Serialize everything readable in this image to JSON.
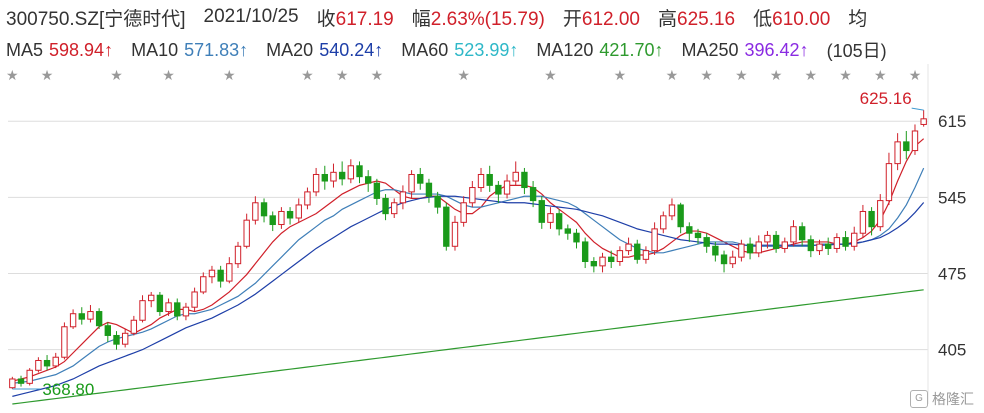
{
  "header": {
    "code": "300750.SZ[宁德时代]",
    "date": "2021/10/25",
    "close_label": "收",
    "close": "617.19",
    "chg_label": "幅",
    "chg": "2.63%(15.79)",
    "open_label": "开",
    "open": "612.00",
    "high_label": "高",
    "high": "625.16",
    "low_label": "低",
    "low": "610.00",
    "avg_label": "均"
  },
  "ma_legend": [
    {
      "label": "MA5",
      "value": "598.94↑",
      "color": "#d0202a"
    },
    {
      "label": "MA10",
      "value": "571.83↑",
      "color": "#3f7fb8"
    },
    {
      "label": "MA20",
      "value": "540.24↑",
      "color": "#1e3fa8"
    },
    {
      "label": "MA60",
      "value": "523.99↑",
      "color": "#2fb8c8"
    },
    {
      "label": "MA120",
      "value": "421.70↑",
      "color": "#2e9a2e"
    },
    {
      "label": "MA250",
      "value": "396.42↑",
      "color": "#8a2be2"
    },
    {
      "label": "",
      "value": "(105日)",
      "color": "#333333"
    }
  ],
  "watermark": {
    "logo_text": "G",
    "text": "格隆汇"
  },
  "colors": {
    "up": "#d0202a",
    "down": "#1a9a1a",
    "grid": "#dddddd"
  },
  "chart_data": {
    "type": "candlestick",
    "ylim": [
      355,
      640
    ],
    "yticks": [
      405,
      475,
      545,
      615
    ],
    "high_label": "625.16",
    "low_label": "368.80",
    "candles": [
      [
        370,
        378,
        368.8,
        380
      ],
      [
        378,
        374,
        371,
        381
      ],
      [
        374,
        386,
        372,
        388
      ],
      [
        386,
        395,
        384,
        398
      ],
      [
        395,
        390,
        386,
        400
      ],
      [
        390,
        398,
        388,
        402
      ],
      [
        398,
        426,
        396,
        430
      ],
      [
        426,
        438,
        424,
        442
      ],
      [
        438,
        433,
        428,
        444
      ],
      [
        433,
        440,
        430,
        446
      ],
      [
        440,
        427,
        424,
        443
      ],
      [
        427,
        418,
        412,
        430
      ],
      [
        418,
        410,
        405,
        422
      ],
      [
        410,
        420,
        407,
        424
      ],
      [
        420,
        432,
        418,
        436
      ],
      [
        432,
        450,
        430,
        455
      ],
      [
        450,
        455,
        444,
        458
      ],
      [
        455,
        440,
        436,
        458
      ],
      [
        440,
        448,
        436,
        452
      ],
      [
        448,
        436,
        432,
        452
      ],
      [
        436,
        444,
        432,
        448
      ],
      [
        444,
        458,
        440,
        462
      ],
      [
        458,
        472,
        456,
        476
      ],
      [
        472,
        478,
        466,
        482
      ],
      [
        478,
        468,
        462,
        482
      ],
      [
        468,
        484,
        466,
        490
      ],
      [
        484,
        500,
        480,
        504
      ],
      [
        500,
        524,
        498,
        530
      ],
      [
        524,
        540,
        520,
        546
      ],
      [
        540,
        528,
        522,
        544
      ],
      [
        528,
        520,
        514,
        532
      ],
      [
        520,
        532,
        516,
        536
      ],
      [
        532,
        526,
        520,
        536
      ],
      [
        526,
        538,
        522,
        544
      ],
      [
        538,
        550,
        534,
        554
      ],
      [
        550,
        566,
        546,
        572
      ],
      [
        566,
        560,
        552,
        574
      ],
      [
        560,
        568,
        554,
        576
      ],
      [
        568,
        562,
        556,
        578
      ],
      [
        562,
        574,
        558,
        580
      ],
      [
        574,
        564,
        558,
        578
      ],
      [
        564,
        558,
        550,
        570
      ],
      [
        558,
        544,
        538,
        562
      ],
      [
        544,
        530,
        524,
        548
      ],
      [
        530,
        540,
        526,
        544
      ],
      [
        540,
        550,
        534,
        556
      ],
      [
        550,
        566,
        544,
        570
      ],
      [
        566,
        558,
        552,
        572
      ],
      [
        558,
        546,
        540,
        562
      ],
      [
        546,
        536,
        530,
        550
      ],
      [
        536,
        500,
        496,
        540
      ],
      [
        500,
        522,
        496,
        528
      ],
      [
        522,
        540,
        518,
        546
      ],
      [
        540,
        554,
        536,
        560
      ],
      [
        554,
        566,
        550,
        572
      ],
      [
        566,
        556,
        550,
        574
      ],
      [
        556,
        548,
        540,
        560
      ],
      [
        548,
        560,
        544,
        566
      ],
      [
        560,
        568,
        556,
        578
      ],
      [
        568,
        554,
        548,
        572
      ],
      [
        554,
        542,
        536,
        560
      ],
      [
        542,
        522,
        516,
        546
      ],
      [
        522,
        530,
        516,
        536
      ],
      [
        530,
        516,
        510,
        534
      ],
      [
        516,
        512,
        506,
        520
      ],
      [
        512,
        504,
        498,
        516
      ],
      [
        504,
        486,
        480,
        508
      ],
      [
        486,
        482,
        476,
        490
      ],
      [
        482,
        490,
        476,
        494
      ],
      [
        490,
        486,
        480,
        496
      ],
      [
        486,
        496,
        482,
        500
      ],
      [
        496,
        502,
        492,
        508
      ],
      [
        502,
        488,
        484,
        506
      ],
      [
        488,
        496,
        484,
        500
      ],
      [
        496,
        516,
        492,
        522
      ],
      [
        516,
        528,
        512,
        532
      ],
      [
        528,
        538,
        524,
        544
      ],
      [
        538,
        518,
        512,
        540
      ],
      [
        518,
        512,
        504,
        522
      ],
      [
        512,
        508,
        502,
        516
      ],
      [
        508,
        500,
        494,
        512
      ],
      [
        500,
        492,
        486,
        504
      ],
      [
        492,
        484,
        476,
        496
      ],
      [
        484,
        490,
        480,
        496
      ],
      [
        490,
        502,
        486,
        506
      ],
      [
        502,
        494,
        488,
        508
      ],
      [
        494,
        504,
        490,
        510
      ],
      [
        504,
        510,
        498,
        514
      ],
      [
        510,
        498,
        494,
        514
      ],
      [
        498,
        504,
        494,
        508
      ],
      [
        504,
        518,
        500,
        524
      ],
      [
        518,
        506,
        500,
        522
      ],
      [
        506,
        496,
        490,
        510
      ],
      [
        496,
        502,
        492,
        506
      ],
      [
        502,
        498,
        492,
        508
      ],
      [
        498,
        508,
        494,
        512
      ],
      [
        508,
        500,
        496,
        514
      ],
      [
        500,
        512,
        496,
        518
      ],
      [
        512,
        532,
        508,
        538
      ],
      [
        532,
        518,
        510,
        536
      ],
      [
        518,
        542,
        514,
        548
      ],
      [
        542,
        576,
        538,
        586
      ],
      [
        576,
        596,
        570,
        604
      ],
      [
        596,
        588,
        580,
        606
      ],
      [
        588,
        606,
        584,
        612
      ],
      [
        612,
        617.19,
        610,
        625.16
      ]
    ],
    "series": [
      {
        "name": "MA5",
        "color": "#d0202a",
        "values": [
          376,
          378,
          380,
          383,
          386,
          389,
          394,
          402,
          410,
          418,
          426,
          430,
          428,
          424,
          420,
          424,
          428,
          434,
          438,
          442,
          442,
          440,
          442,
          446,
          452,
          458,
          466,
          474,
          484,
          494,
          504,
          512,
          518,
          522,
          526,
          530,
          536,
          542,
          548,
          552,
          556,
          558,
          560,
          558,
          552,
          546,
          544,
          544,
          546,
          546,
          540,
          534,
          530,
          530,
          536,
          546,
          552,
          556,
          556,
          556,
          554,
          548,
          540,
          534,
          528,
          522,
          512,
          504,
          498,
          494,
          490,
          490,
          492,
          492,
          494,
          498,
          504,
          510,
          514,
          514,
          512,
          508,
          504,
          500,
          496,
          494,
          494,
          496,
          498,
          500,
          502,
          504,
          504,
          504,
          504,
          502,
          502,
          504,
          508,
          514,
          524,
          540,
          560,
          578,
          592,
          598.94
        ]
      },
      {
        "name": "MA10",
        "color": "#3f7fb8",
        "values": [
          374,
          375,
          376,
          378,
          380,
          382,
          386,
          390,
          396,
          402,
          408,
          412,
          415,
          417,
          419,
          421,
          424,
          428,
          432,
          436,
          438,
          438,
          440,
          442,
          446,
          450,
          454,
          460,
          466,
          474,
          482,
          490,
          498,
          506,
          512,
          518,
          524,
          528,
          534,
          538,
          542,
          546,
          550,
          552,
          552,
          550,
          548,
          548,
          548,
          548,
          546,
          542,
          538,
          536,
          536,
          538,
          540,
          542,
          544,
          546,
          546,
          546,
          544,
          542,
          540,
          536,
          530,
          524,
          518,
          512,
          506,
          502,
          498,
          496,
          494,
          494,
          496,
          498,
          500,
          502,
          504,
          504,
          504,
          504,
          502,
          500,
          500,
          500,
          500,
          500,
          500,
          500,
          500,
          502,
          502,
          502,
          502,
          502,
          504,
          506,
          510,
          516,
          526,
          538,
          554,
          571.83
        ]
      },
      {
        "name": "MA20",
        "color": "#1e3fa8",
        "values": [
          362,
          364,
          366,
          368,
          370,
          372,
          375,
          378,
          382,
          386,
          390,
          393,
          396,
          399,
          402,
          405,
          409,
          413,
          417,
          421,
          425,
          428,
          431,
          434,
          438,
          442,
          446,
          451,
          456,
          462,
          468,
          474,
          480,
          486,
          492,
          498,
          503,
          508,
          513,
          518,
          522,
          526,
          530,
          534,
          537,
          540,
          542,
          544,
          545,
          546,
          546,
          546,
          545,
          544,
          543,
          542,
          541,
          540,
          540,
          540,
          539,
          538,
          537,
          536,
          535,
          534,
          532,
          530,
          528,
          525,
          522,
          519,
          516,
          514,
          512,
          510,
          508,
          506,
          505,
          504,
          503,
          502,
          502,
          502,
          501,
          501,
          501,
          501,
          501,
          501,
          501,
          501,
          501,
          501,
          501,
          502,
          502,
          503,
          504,
          506,
          508,
          512,
          517,
          523,
          531,
          540.24
        ]
      },
      {
        "name": "MA60",
        "color": "#2fb8c8",
        "values": [
          null,
          null,
          null,
          null,
          null,
          null,
          null,
          null,
          null,
          null,
          null,
          null,
          null,
          null,
          null,
          null,
          null,
          null,
          null,
          null,
          null,
          null,
          null,
          null,
          null,
          null,
          null,
          null,
          null,
          null,
          null,
          null,
          null,
          null,
          null,
          null,
          null,
          null,
          null,
          null,
          null,
          null,
          null,
          null,
          null,
          null,
          null,
          null,
          null,
          null,
          null,
          null,
          null,
          null,
          null,
          null,
          null,
          null,
          null,
          null,
          null,
          null,
          null,
          null,
          null,
          null,
          null,
          null,
          null,
          null,
          null,
          null,
          null,
          null,
          null,
          null,
          null,
          null,
          null,
          null,
          null,
          null,
          null,
          null,
          null,
          null,
          null,
          null,
          null,
          null,
          null,
          null,
          null,
          null,
          null,
          null,
          null,
          null,
          null,
          null,
          null,
          null,
          null,
          null,
          null,
          null
        ]
      },
      {
        "name": "MA120",
        "color": "#2e9a2e",
        "values": [
          355,
          356,
          357,
          358,
          359,
          360,
          361,
          362,
          363,
          364,
          365,
          366,
          367,
          368,
          369,
          370,
          371,
          372,
          373,
          374,
          375,
          376,
          377,
          378,
          379,
          380,
          381,
          382,
          383,
          384,
          385,
          386,
          387,
          388,
          389,
          390,
          391,
          392,
          393,
          394,
          395,
          396,
          397,
          398,
          399,
          400,
          401,
          402,
          403,
          404,
          405,
          406,
          407,
          408,
          409,
          410,
          411,
          412,
          413,
          414,
          415,
          416,
          417,
          418,
          419,
          420,
          421,
          422,
          423,
          424,
          425,
          426,
          427,
          428,
          429,
          430,
          431,
          432,
          433,
          434,
          435,
          436,
          437,
          438,
          439,
          440,
          441,
          442,
          443,
          444,
          445,
          446,
          447,
          448,
          449,
          450,
          451,
          452,
          453,
          454,
          455,
          456,
          457,
          458,
          459,
          460
        ]
      },
      {
        "name": "MA250",
        "color": "#8a2be2",
        "values": [
          null,
          null,
          null,
          null,
          null,
          null,
          null,
          null,
          null,
          null,
          null,
          null,
          null,
          null,
          null,
          null,
          null,
          null,
          null,
          null,
          null,
          null,
          null,
          null,
          null,
          null,
          null,
          null,
          null,
          null,
          null,
          null,
          null,
          null,
          null,
          null,
          null,
          null,
          null,
          null,
          null,
          null,
          null,
          null,
          null,
          null,
          null,
          null,
          null,
          null,
          null,
          null,
          null,
          null,
          null,
          null,
          null,
          null,
          null,
          null,
          null,
          null,
          null,
          null,
          null,
          null,
          null,
          null,
          null,
          null,
          null,
          null,
          null,
          null,
          null,
          null,
          null,
          null,
          null,
          null,
          null,
          null,
          null,
          null,
          null,
          null,
          null,
          null,
          null,
          null,
          null,
          null,
          null,
          null,
          null,
          null,
          null,
          null,
          null,
          null,
          null,
          null,
          null,
          null,
          null,
          null
        ]
      }
    ]
  }
}
